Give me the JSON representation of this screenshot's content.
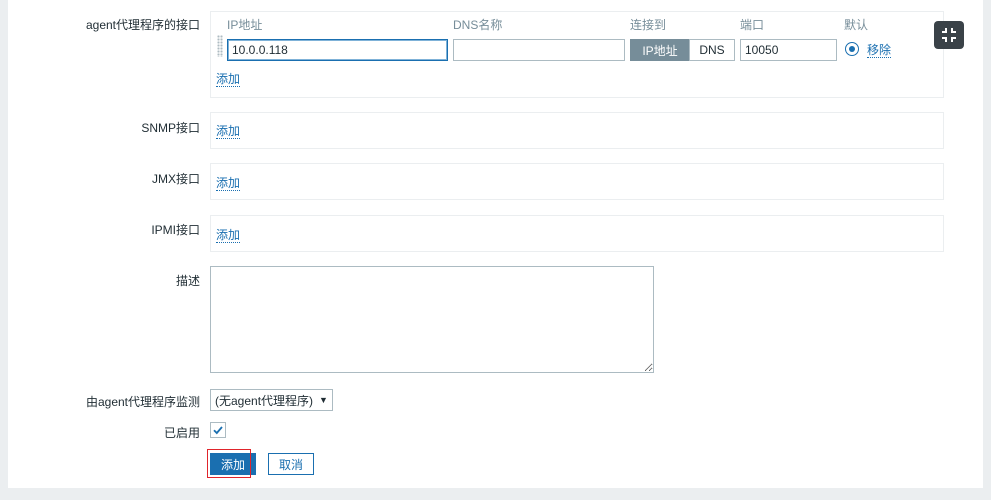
{
  "interfaces": {
    "agent": {
      "label": "agent代理程序的接口",
      "columns": {
        "ip": "IP地址",
        "dns": "DNS名称",
        "connect_to": "连接到",
        "port": "端口",
        "default": "默认"
      },
      "row": {
        "ip_value": "10.0.0.118",
        "dns_value": "",
        "connect_ip": "IP地址",
        "connect_dns": "DNS",
        "port_value": "10050",
        "remove": "移除"
      },
      "add": "添加"
    },
    "snmp": {
      "label": "SNMP接口",
      "add": "添加"
    },
    "jmx": {
      "label": "JMX接口",
      "add": "添加"
    },
    "ipmi": {
      "label": "IPMI接口",
      "add": "添加"
    }
  },
  "description": {
    "label": "描述",
    "value": ""
  },
  "proxy": {
    "label": "由agent代理程序监测",
    "selected": "(无agent代理程序)"
  },
  "enabled": {
    "label": "已启用",
    "checked": true
  },
  "buttons": {
    "add": "添加",
    "cancel": "取消"
  },
  "colors": {
    "accent": "#1a6fb0",
    "highlight": "#e0242b"
  }
}
